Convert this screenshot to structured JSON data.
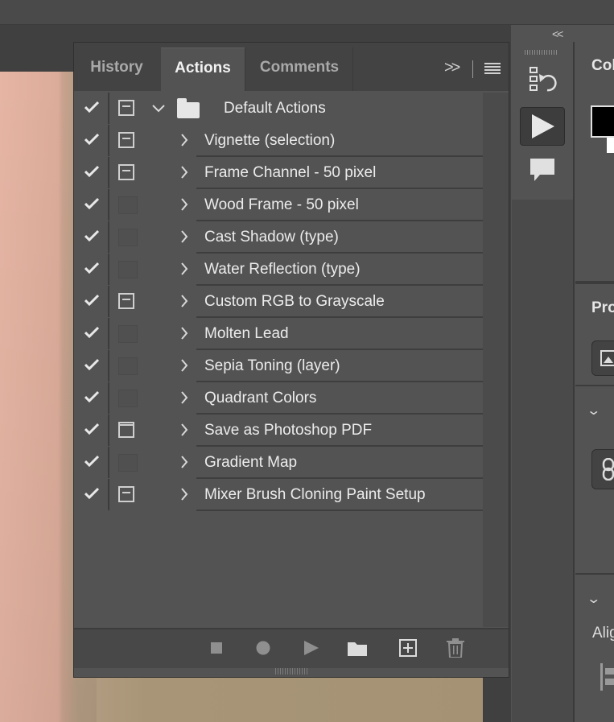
{
  "panel": {
    "tabs": [
      {
        "label": "History",
        "active": false
      },
      {
        "label": "Actions",
        "active": true
      },
      {
        "label": "Comments",
        "active": false
      }
    ],
    "overflow_label": ">>",
    "menu_icon": "panel-menu-icon"
  },
  "actions": {
    "set": {
      "name": "Default Actions",
      "enabled": true,
      "dialog": true,
      "expanded": true
    },
    "items": [
      {
        "name": "Vignette (selection)",
        "enabled": true,
        "dialog": true
      },
      {
        "name": "Frame Channel - 50 pixel",
        "enabled": true,
        "dialog": true
      },
      {
        "name": "Wood Frame - 50 pixel",
        "enabled": true,
        "dialog": false
      },
      {
        "name": "Cast Shadow (type)",
        "enabled": true,
        "dialog": false
      },
      {
        "name": "Water Reflection (type)",
        "enabled": true,
        "dialog": false
      },
      {
        "name": "Custom RGB to Grayscale",
        "enabled": true,
        "dialog": true
      },
      {
        "name": "Molten Lead",
        "enabled": true,
        "dialog": false
      },
      {
        "name": "Sepia Toning (layer)",
        "enabled": true,
        "dialog": false
      },
      {
        "name": "Quadrant Colors",
        "enabled": true,
        "dialog": false
      },
      {
        "name": "Save as Photoshop PDF",
        "enabled": true,
        "dialog": "partial"
      },
      {
        "name": "Gradient Map",
        "enabled": true,
        "dialog": false
      },
      {
        "name": "Mixer Brush Cloning Paint Setup",
        "enabled": true,
        "dialog": true
      }
    ]
  },
  "bottom_toolbar": [
    "stop-icon",
    "record-icon",
    "play-icon",
    "new-set-folder-icon",
    "new-action-icon",
    "trash-icon"
  ],
  "right_panels": {
    "color_title": "Color",
    "properties_title": "Properties",
    "align_label": "Align",
    "collapse_label": "<<"
  },
  "colors": {
    "foreground": "#000000",
    "background": "#ffffff",
    "panel_bg": "#535353"
  }
}
